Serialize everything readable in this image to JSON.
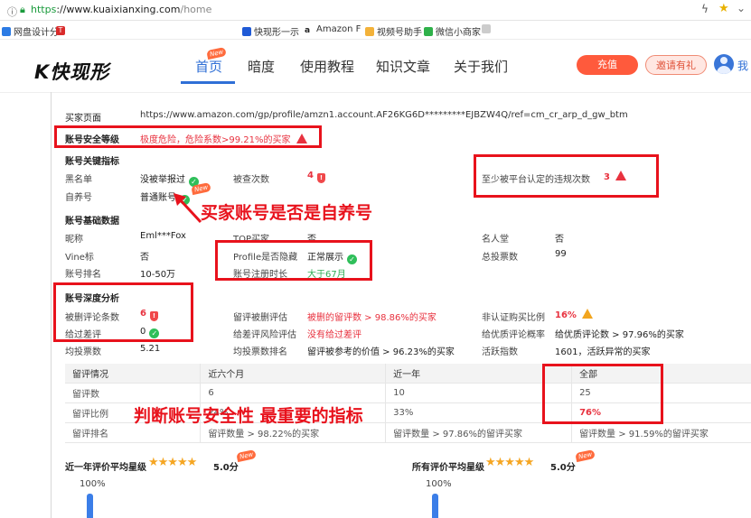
{
  "browser": {
    "secure_label": "https",
    "url_host": "://www.kuaixianxing.com",
    "url_path": "/home",
    "bookmarks": [
      "网盘设计分",
      "T",
      "快现形一示",
      "Amazon F",
      "视频号助手",
      "微信小商家",
      ""
    ]
  },
  "nav": {
    "logo": "K快现形",
    "items": [
      {
        "label": "首页",
        "active": true
      },
      {
        "label": "暗度"
      },
      {
        "label": "使用教程"
      },
      {
        "label": "知识文章"
      },
      {
        "label": "关于我们"
      }
    ],
    "new_tag": "New",
    "btn_orange": "充值",
    "btn_invite": "邀请有礼",
    "me": "我"
  },
  "profile": {
    "url_label": "买家页面",
    "url_value": "https://www.amazon.com/gp/profile/amzn1.account.AF26KG6D*********EJBZW4Q/ref=cm_cr_arp_d_gw_btm",
    "safety_label": "账号安全等级",
    "safety_value": "极度危险，危险系数>99.21%的买家"
  },
  "key": {
    "title": "账号关键指标",
    "blacklist_label": "黑名单",
    "blacklist_value": "没被举报过",
    "reported_label": "被查次数",
    "reported_value": "4",
    "violation_label": "至少被平台认定的违规次数",
    "violation_value": "3",
    "self_label": "自养号",
    "self_value": "普通账号"
  },
  "basic": {
    "title": "账号基础数据",
    "nick_label": "昵称",
    "nick_value": "Eml***Fox",
    "top_label": "TOP买家",
    "top_value": "否",
    "celeb_label": "名人堂",
    "celeb_value": "否",
    "vine_label": "Vine标",
    "vine_value": "否",
    "profile_label": "Profile是否隐藏",
    "profile_value": "正常展示",
    "votes_label": "总投票数",
    "votes_value": "99",
    "rank_label": "账号排名",
    "rank_value": "10-50万",
    "regtime_label": "账号注册时长",
    "regtime_value": "大于67月"
  },
  "depth": {
    "title": "账号深度分析",
    "deleted_label": "被删评论条数",
    "deleted_value": "6",
    "del_est_label": "留评被删评估",
    "del_est_value": "被删的留评数 > 98.86%的买家",
    "nonverified_label": "非认证购买比例",
    "nonverified_value": "16%",
    "over_label": "给过差评",
    "over_value": "0",
    "badrisk_label": "给差评风险评估",
    "badrisk_value": "没有给过差评",
    "goodrate_label": "给优质评论概率",
    "goodrate_value": "给优质评论数 > 97.96%的买家",
    "avgvote_label": "均投票数",
    "avgvote_value": "5.21",
    "avgvote_rank_label": "均投票数排名",
    "avgvote_rank_value": "留评被参考的价值 > 96.23%的买家",
    "active_label": "活跃指数",
    "active_value": "1601，活跃异常的买家"
  },
  "table": {
    "headers": [
      "留评情况",
      "近六个月",
      "近一年",
      "全部"
    ],
    "rows": [
      [
        "留评数",
        "6",
        "10",
        "25"
      ],
      [
        "留评比例",
        "24%",
        "33%",
        "76%"
      ],
      [
        "留评排名",
        "留评数量 > 98.22%的买家",
        "留评数量 > 97.86%的留评买家",
        "留评数量 > 91.59%的留评买家"
      ]
    ]
  },
  "ratings": {
    "year_label": "近一年评价平均星级",
    "year_value": "5.0分",
    "all_label": "所有评价平均星级",
    "all_value": "5.0分",
    "bar_label": "100%",
    "bar_label2": "100%"
  },
  "annotations": {
    "self_note": "买家账号是否是自养号",
    "key_note": "判断账号安全性 最重要的指标"
  },
  "colors": {
    "red": "#e8323f",
    "blue": "#2f6fd6",
    "green": "#2fae55"
  }
}
